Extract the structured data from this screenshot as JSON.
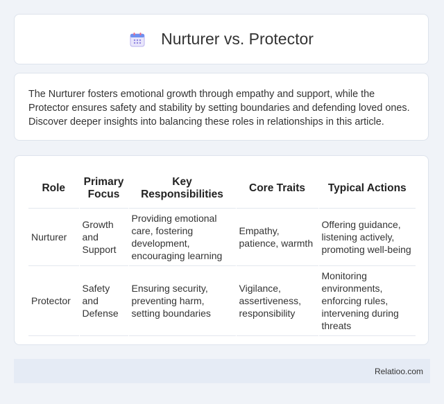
{
  "header": {
    "icon": "calendar-icon",
    "title": "Nurturer vs. Protector"
  },
  "intro": {
    "text": "The Nurturer fosters emotional growth through empathy and support, while the Protector ensures safety and stability by setting boundaries and defending loved ones. Discover deeper insights into balancing these roles in relationships in this article."
  },
  "table": {
    "columns": [
      "Role",
      "Primary Focus",
      "Key Responsibilities",
      "Core Traits",
      "Typical Actions"
    ],
    "rows": [
      [
        "Nurturer",
        "Growth and Support",
        "Providing emotional care, fostering development, encouraging learning",
        "Empathy, patience, warmth",
        "Offering guidance, listening actively, promoting well-being"
      ],
      [
        "Protector",
        "Safety and Defense",
        "Ensuring security, preventing harm, setting boundaries",
        "Vigilance, assertiveness, responsibility",
        "Monitoring environments, enforcing rules, intervening during threats"
      ]
    ]
  },
  "footer": {
    "brand": "Relatioo.com"
  }
}
